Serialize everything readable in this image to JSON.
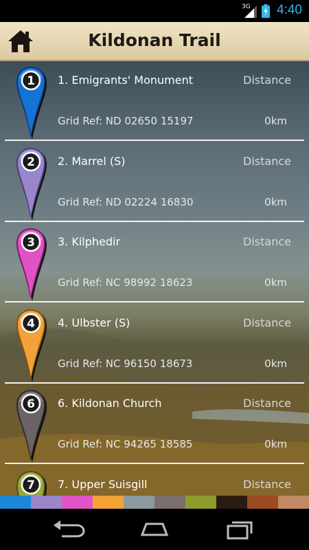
{
  "status_bar": {
    "network": "3G",
    "time": "4:40"
  },
  "header": {
    "title": "Kildonan Trail"
  },
  "colors": {
    "strip": [
      "#1e88d8",
      "#9b86c9",
      "#e155c8",
      "#f3a336",
      "#8a9a9e",
      "#7a6f6d",
      "#8d9a2c",
      "#2c1b10",
      "#9c4b22",
      "#c08a66"
    ]
  },
  "stops": [
    {
      "number": "1",
      "name": "1. Emigrants' Monument",
      "distance_label": "Distance",
      "grid_ref": "Grid Ref: ND 02650 15197",
      "distance_value": "0km",
      "pin_color": "#1673d6",
      "pin_dark": "#0c3d78"
    },
    {
      "number": "2",
      "name": "2. Marrel (S)",
      "distance_label": "Distance",
      "grid_ref": "Grid Ref: ND 02224 16830",
      "distance_value": "0km",
      "pin_color": "#9a86cc",
      "pin_dark": "#4c3f78"
    },
    {
      "number": "3",
      "name": "3. Kilphedir",
      "distance_label": "Distance",
      "grid_ref": "Grid Ref: NC 98992 18623",
      "distance_value": "0km",
      "pin_color": "#e053c4",
      "pin_dark": "#7a1c68"
    },
    {
      "number": "4",
      "name": "4. Ulbster (S)",
      "distance_label": "Distance",
      "grid_ref": "Grid Ref: NC 96150 18673",
      "distance_value": "0km",
      "pin_color": "#f2a23a",
      "pin_dark": "#8a5410"
    },
    {
      "number": "6",
      "name": "6. Kildonan Church",
      "distance_label": "Distance",
      "grid_ref": "Grid Ref: NC 94265 18585",
      "distance_value": "0km",
      "pin_color": "#6b6466",
      "pin_dark": "#2e2a2b"
    },
    {
      "number": "7",
      "name": "7. Upper Suisgill",
      "distance_label": "Distance",
      "grid_ref": "",
      "distance_value": "",
      "pin_color": "#9aa63a",
      "pin_dark": "#4a5210"
    }
  ]
}
